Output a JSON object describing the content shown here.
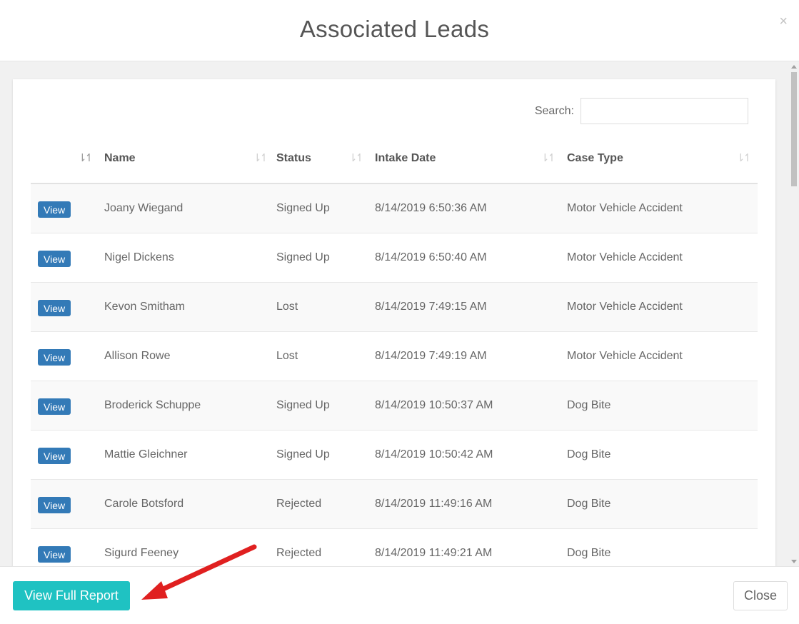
{
  "modal": {
    "title": "Associated Leads",
    "close_glyph": "×"
  },
  "search": {
    "label": "Search:",
    "value": ""
  },
  "table": {
    "columns": [
      "Name",
      "Status",
      "Intake Date",
      "Case Type"
    ],
    "rows": [
      {
        "action": "View",
        "name": "Joany Wiegand",
        "status": "Signed Up",
        "intake_date": "8/14/2019 6:50:36 AM",
        "case_type": "Motor Vehicle Accident"
      },
      {
        "action": "View",
        "name": "Nigel Dickens",
        "status": "Signed Up",
        "intake_date": "8/14/2019 6:50:40 AM",
        "case_type": "Motor Vehicle Accident"
      },
      {
        "action": "View",
        "name": "Kevon Smitham",
        "status": "Lost",
        "intake_date": "8/14/2019 7:49:15 AM",
        "case_type": "Motor Vehicle Accident"
      },
      {
        "action": "View",
        "name": "Allison Rowe",
        "status": "Lost",
        "intake_date": "8/14/2019 7:49:19 AM",
        "case_type": "Motor Vehicle Accident"
      },
      {
        "action": "View",
        "name": "Broderick Schuppe",
        "status": "Signed Up",
        "intake_date": "8/14/2019 10:50:37 AM",
        "case_type": "Dog Bite"
      },
      {
        "action": "View",
        "name": "Mattie Gleichner",
        "status": "Signed Up",
        "intake_date": "8/14/2019 10:50:42 AM",
        "case_type": "Dog Bite"
      },
      {
        "action": "View",
        "name": "Carole Botsford",
        "status": "Rejected",
        "intake_date": "8/14/2019 11:49:16 AM",
        "case_type": "Dog Bite"
      },
      {
        "action": "View",
        "name": "Sigurd Feeney",
        "status": "Rejected",
        "intake_date": "8/14/2019 11:49:21 AM",
        "case_type": "Dog Bite"
      }
    ]
  },
  "footer": {
    "report_label": "View Full Report",
    "close_label": "Close"
  },
  "colors": {
    "primary_button": "#337ab7",
    "report_button": "#1fc2c2",
    "annotation_arrow": "#e02020"
  }
}
